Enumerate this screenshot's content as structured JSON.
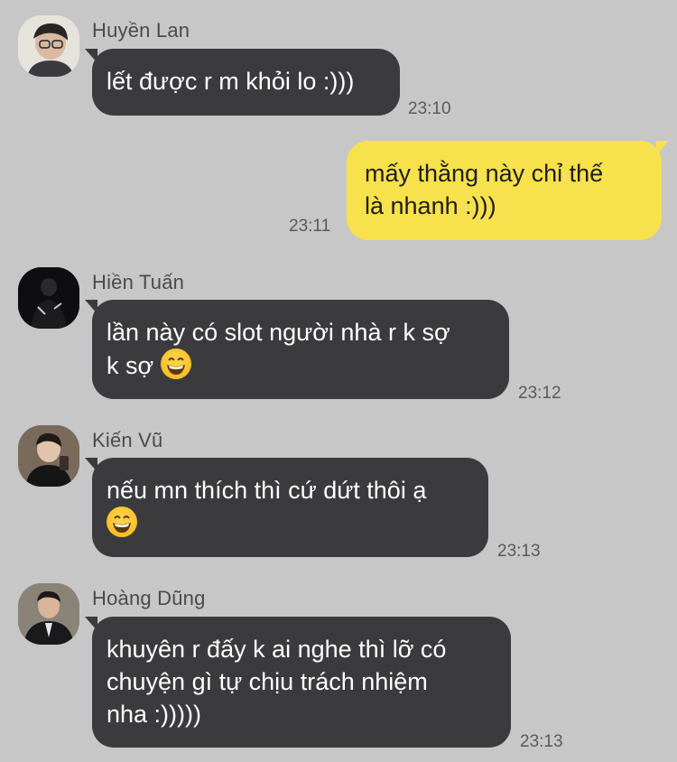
{
  "messages": [
    {
      "sender": "Huyền Lan",
      "lines": [
        "lết được r m khỏi lo :)))"
      ],
      "time": "23:10"
    },
    {
      "sender": "",
      "lines": [
        "mấy thằng này chỉ thế",
        "là nhanh :)))"
      ],
      "time": "23:11",
      "mine": true
    },
    {
      "sender": "Hiền Tuấn",
      "lines": [
        "lần này có slot người nhà r k sợ",
        "k sợ"
      ],
      "time": "23:12"
    },
    {
      "sender": "Kiến Vũ",
      "lines": [
        "nếu mn thích thì cứ dứt thôi ạ",
        ""
      ],
      "time": "23:13"
    },
    {
      "sender": "Hoàng Dũng",
      "lines": [
        "khuyên r đấy k ai nghe thì lỡ có",
        "chuyện gì tự chịu trách nhiệm",
        "nha :)))))"
      ],
      "time": "23:13"
    }
  ],
  "colors": {
    "background": "#c7c7c7",
    "incoming_bubble": "#3b3b3d",
    "outgoing_bubble": "#f7e14c"
  },
  "icons": {
    "emoji": "grinning-face-with-smiling-eyes-icon"
  }
}
